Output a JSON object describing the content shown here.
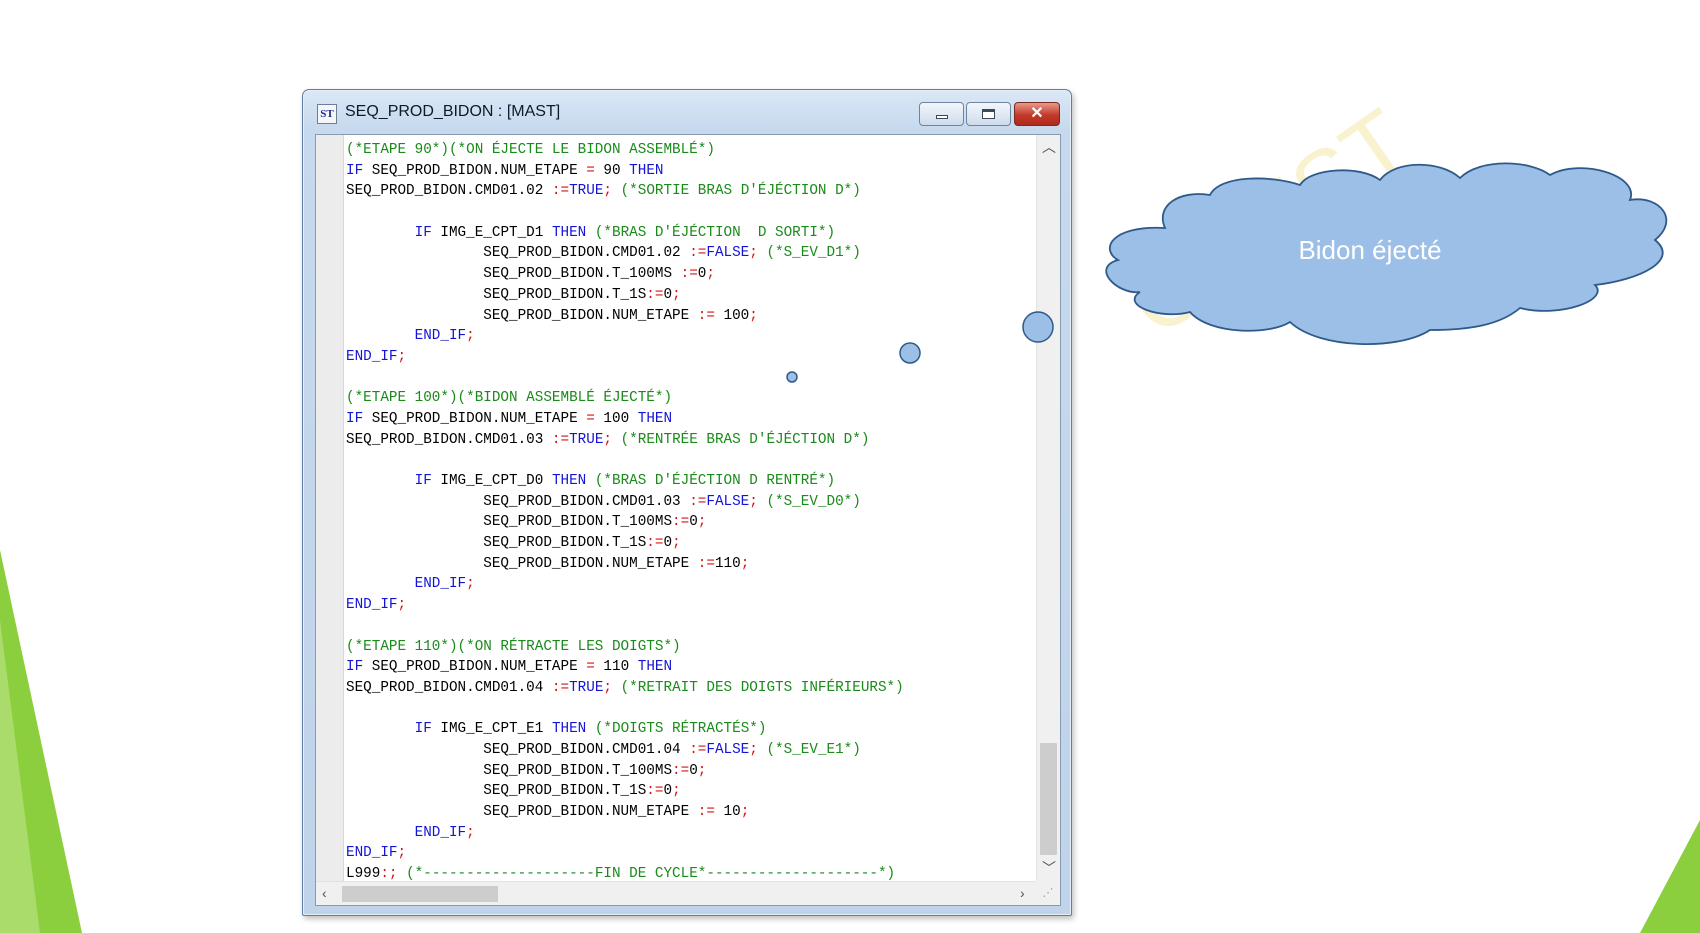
{
  "window": {
    "title": "SEQ_PROD_BIDON : [MAST]",
    "app_icon_label": "ST",
    "icons": {
      "minimize": "minimize-icon",
      "maximize": "maximize-icon",
      "close": "close-icon"
    }
  },
  "editor": {
    "lines": [
      [
        [
          "(*ETAPE 90*)(*ON ÉJECTE LE BIDON ASSEMBLÉ*)",
          "cm"
        ]
      ],
      [
        [
          "IF",
          "kw"
        ],
        [
          " SEQ_PROD_BIDON.NUM_ETAPE ",
          "tx"
        ],
        [
          "=",
          "op"
        ],
        [
          " 90 ",
          "tx"
        ],
        [
          "THEN",
          "kw"
        ]
      ],
      [
        [
          "SEQ_PROD_BIDON.CMD01.02 ",
          "tx"
        ],
        [
          ":=",
          "op"
        ],
        [
          "TRUE",
          "kw"
        ],
        [
          ";",
          "op"
        ],
        [
          " (*SORTIE BRAS D'ÉJÉCTION D*)",
          "cm"
        ]
      ],
      [],
      [
        [
          "        ",
          "tx"
        ],
        [
          "IF",
          "kw"
        ],
        [
          " IMG_E_CPT_D1 ",
          "tx"
        ],
        [
          "THEN",
          "kw"
        ],
        [
          " (*BRAS D'ÉJÉCTION  D SORTI*)",
          "cm"
        ]
      ],
      [
        [
          "                SEQ_PROD_BIDON.CMD01.02 ",
          "tx"
        ],
        [
          ":=",
          "op"
        ],
        [
          "FALSE",
          "kw"
        ],
        [
          ";",
          "op"
        ],
        [
          " (*S_EV_D1*)",
          "cm"
        ]
      ],
      [
        [
          "                SEQ_PROD_BIDON.T_100MS ",
          "tx"
        ],
        [
          ":=",
          "op"
        ],
        [
          "0",
          "tx"
        ],
        [
          ";",
          "op"
        ]
      ],
      [
        [
          "                SEQ_PROD_BIDON.T_1S",
          "tx"
        ],
        [
          ":=",
          "op"
        ],
        [
          "0",
          "tx"
        ],
        [
          ";",
          "op"
        ]
      ],
      [
        [
          "                SEQ_PROD_BIDON.NUM_ETAPE ",
          "tx"
        ],
        [
          ":=",
          "op"
        ],
        [
          " 100",
          "tx"
        ],
        [
          ";",
          "op"
        ]
      ],
      [
        [
          "        ",
          "tx"
        ],
        [
          "END_IF",
          "kw"
        ],
        [
          ";",
          "op"
        ]
      ],
      [
        [
          "END_IF",
          "kw"
        ],
        [
          ";",
          "op"
        ]
      ],
      [],
      [
        [
          "(*ETAPE 100*)(*BIDON ASSEMBLÉ ÉJECTÉ*)",
          "cm"
        ]
      ],
      [
        [
          "IF",
          "kw"
        ],
        [
          " SEQ_PROD_BIDON.NUM_ETAPE ",
          "tx"
        ],
        [
          "=",
          "op"
        ],
        [
          " 100 ",
          "tx"
        ],
        [
          "THEN",
          "kw"
        ]
      ],
      [
        [
          "SEQ_PROD_BIDON.CMD01.03 ",
          "tx"
        ],
        [
          ":=",
          "op"
        ],
        [
          "TRUE",
          "kw"
        ],
        [
          ";",
          "op"
        ],
        [
          " (*RENTRÉE BRAS D'ÉJÉCTION D*)",
          "cm"
        ]
      ],
      [],
      [
        [
          "        ",
          "tx"
        ],
        [
          "IF",
          "kw"
        ],
        [
          " IMG_E_CPT_D0 ",
          "tx"
        ],
        [
          "THEN",
          "kw"
        ],
        [
          " (*BRAS D'ÉJÉCTION D RENTRÉ*)",
          "cm"
        ]
      ],
      [
        [
          "                SEQ_PROD_BIDON.CMD01.03 ",
          "tx"
        ],
        [
          ":=",
          "op"
        ],
        [
          "FALSE",
          "kw"
        ],
        [
          ";",
          "op"
        ],
        [
          " (*S_EV_D0*)",
          "cm"
        ]
      ],
      [
        [
          "                SEQ_PROD_BIDON.T_100MS",
          "tx"
        ],
        [
          ":=",
          "op"
        ],
        [
          "0",
          "tx"
        ],
        [
          ";",
          "op"
        ]
      ],
      [
        [
          "                SEQ_PROD_BIDON.T_1S",
          "tx"
        ],
        [
          ":=",
          "op"
        ],
        [
          "0",
          "tx"
        ],
        [
          ";",
          "op"
        ]
      ],
      [
        [
          "                SEQ_PROD_BIDON.NUM_ETAPE ",
          "tx"
        ],
        [
          ":=",
          "op"
        ],
        [
          "110",
          "tx"
        ],
        [
          ";",
          "op"
        ]
      ],
      [
        [
          "        ",
          "tx"
        ],
        [
          "END_IF",
          "kw"
        ],
        [
          ";",
          "op"
        ]
      ],
      [
        [
          "END_IF",
          "kw"
        ],
        [
          ";",
          "op"
        ]
      ],
      [],
      [
        [
          "(*ETAPE 110*)(*ON RÉTRACTE LES DOIGTS*)",
          "cm"
        ]
      ],
      [
        [
          "IF",
          "kw"
        ],
        [
          " SEQ_PROD_BIDON.NUM_ETAPE ",
          "tx"
        ],
        [
          "=",
          "op"
        ],
        [
          " 110 ",
          "tx"
        ],
        [
          "THEN",
          "kw"
        ]
      ],
      [
        [
          "SEQ_PROD_BIDON.CMD01.04 ",
          "tx"
        ],
        [
          ":=",
          "op"
        ],
        [
          "TRUE",
          "kw"
        ],
        [
          ";",
          "op"
        ],
        [
          " (*RETRAIT DES DOIGTS INFÉRIEURS*)",
          "cm"
        ]
      ],
      [],
      [
        [
          "        ",
          "tx"
        ],
        [
          "IF",
          "kw"
        ],
        [
          " IMG_E_CPT_E1 ",
          "tx"
        ],
        [
          "THEN",
          "kw"
        ],
        [
          " (*DOIGTS RÉTRACTÉS*)",
          "cm"
        ]
      ],
      [
        [
          "                SEQ_PROD_BIDON.CMD01.04 ",
          "tx"
        ],
        [
          ":=",
          "op"
        ],
        [
          "FALSE",
          "kw"
        ],
        [
          ";",
          "op"
        ],
        [
          " (*S_EV_E1*)",
          "cm"
        ]
      ],
      [
        [
          "                SEQ_PROD_BIDON.T_100MS",
          "tx"
        ],
        [
          ":=",
          "op"
        ],
        [
          "0",
          "tx"
        ],
        [
          ";",
          "op"
        ]
      ],
      [
        [
          "                SEQ_PROD_BIDON.T_1S",
          "tx"
        ],
        [
          ":=",
          "op"
        ],
        [
          "0",
          "tx"
        ],
        [
          ";",
          "op"
        ]
      ],
      [
        [
          "                SEQ_PROD_BIDON.NUM_ETAPE ",
          "tx"
        ],
        [
          ":=",
          "op"
        ],
        [
          " 10",
          "tx"
        ],
        [
          ";",
          "op"
        ]
      ],
      [
        [
          "        ",
          "tx"
        ],
        [
          "END_IF",
          "kw"
        ],
        [
          ";",
          "op"
        ]
      ],
      [
        [
          "END_IF",
          "kw"
        ],
        [
          ";",
          "op"
        ]
      ],
      [
        [
          "L999",
          "tx"
        ],
        [
          ":;",
          "op"
        ],
        [
          " (*--------------------FIN DE CYCLE*--------------------*)",
          "cm"
        ]
      ]
    ],
    "scroll_icons": {
      "up": "scroll-up-icon",
      "down": "scroll-down-icon",
      "left": "scroll-left-icon",
      "right": "scroll-right-icon"
    }
  },
  "callout": {
    "text": "Bidon éjecté"
  },
  "colors": {
    "keyword": "#1414d4",
    "comment": "#1a8a1a",
    "operator": "#d41414",
    "cloud_fill": "#9bbfe6",
    "cloud_stroke": "#2e5a8a",
    "accent_green": "#8ccf3e",
    "watermark": "#f5e9a8"
  },
  "watermark": {
    "text": "OUEST"
  }
}
